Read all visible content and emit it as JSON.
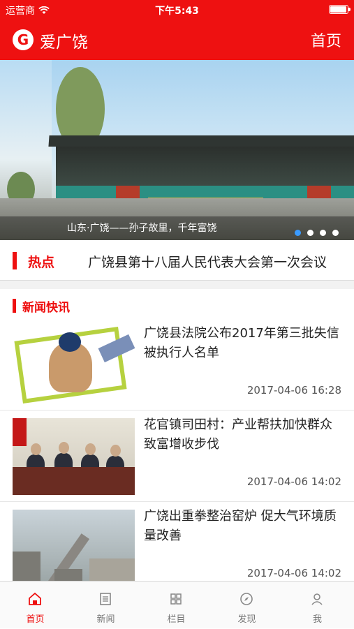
{
  "status_bar": {
    "carrier": "运营商",
    "time": "下午5:43"
  },
  "nav": {
    "app_title": "爱广饶",
    "home_label": "首页"
  },
  "banner": {
    "caption": "山东·广饶——孙子故里，千年富饶",
    "slide_count": 4,
    "active_slide": 1
  },
  "hot": {
    "label": "热点",
    "headline": "广饶县第十八届人民代表大会第一次会议"
  },
  "section": {
    "title": "新闻快讯"
  },
  "news": [
    {
      "title": "广饶县法院公布2017年第三批失信被执行人名单",
      "time": "2017-04-06 16:28"
    },
    {
      "title": "花官镇司田村：产业帮扶加快群众致富增收步伐",
      "time": "2017-04-06 14:02"
    },
    {
      "title": "广饶出重拳整治窑炉 促大气环境质量改善",
      "time": "2017-04-06 14:02"
    }
  ],
  "tabs": [
    {
      "label": "首页",
      "icon": "home-icon",
      "active": true
    },
    {
      "label": "新闻",
      "icon": "news-icon",
      "active": false
    },
    {
      "label": "栏目",
      "icon": "grid-icon",
      "active": false
    },
    {
      "label": "发现",
      "icon": "compass-icon",
      "active": false
    },
    {
      "label": "我",
      "icon": "person-icon",
      "active": false
    }
  ],
  "colors": {
    "brand_red": "#ee1111",
    "active_dot": "#3a9bff"
  }
}
